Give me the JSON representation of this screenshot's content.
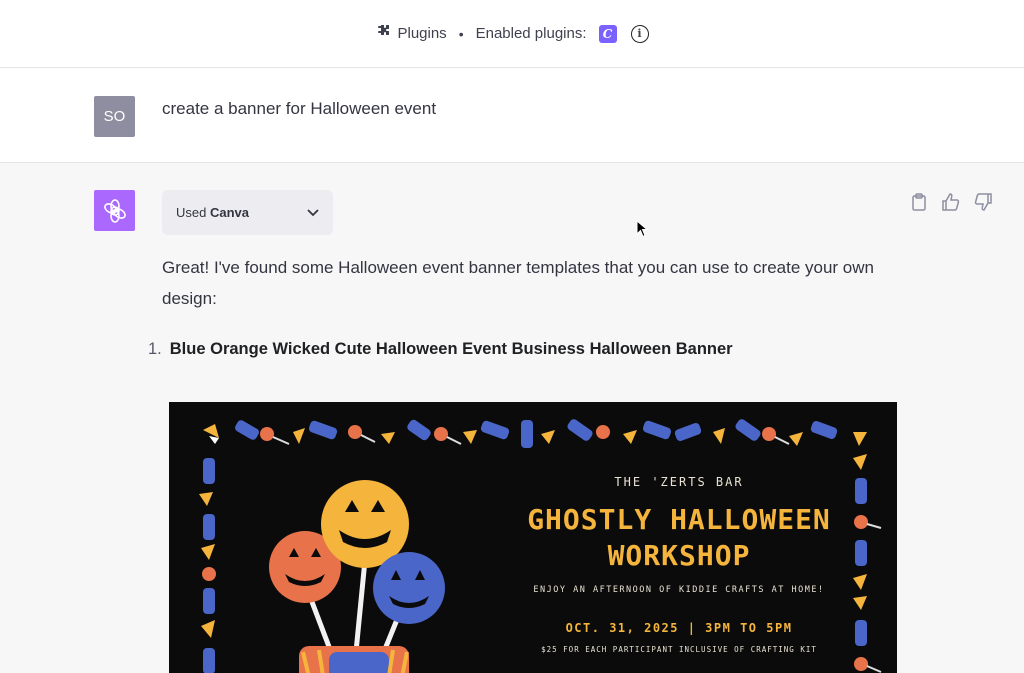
{
  "topbar": {
    "plugins_label": "Plugins",
    "separator": "•",
    "enabled_label": "Enabled plugins:",
    "plugin_badge": "C",
    "info_glyph": "i"
  },
  "user_message": {
    "avatar_initials": "SO",
    "text": "create a banner for Halloween event"
  },
  "assistant": {
    "used_prefix": "Used ",
    "used_plugin": "Canva",
    "answer_text": "Great! I've found some Halloween event banner templates that you can use to create your own design:",
    "list": [
      {
        "number": "1.",
        "title": "Blue Orange Wicked Cute Halloween Event Business Halloween Banner"
      }
    ]
  },
  "banner": {
    "subtitle": "THE 'ZERTS BAR",
    "title_line1": "GHOSTLY HALLOWEEN",
    "title_line2": "WORKSHOP",
    "tagline": "ENJOY AN AFTERNOON  OF KIDDIE CRAFTS AT HOME!",
    "date": "OCT. 31, 2025 | 3PM TO 5PM",
    "price": "$25 FOR EACH PARTICIPANT INCLUSIVE OF CRAFTING KIT"
  },
  "colors": {
    "bot_avatar": "#ab68ff",
    "user_avatar": "#8e8ea0",
    "banner_bg": "#0b0b0b",
    "banner_accent": "#f5b53d",
    "pumpkin_orange": "#e8734a",
    "pumpkin_yellow": "#f5b53d",
    "pumpkin_blue": "#4a66c8"
  },
  "icons": [
    "puzzle-icon",
    "info-icon",
    "openai-logo-icon",
    "chevron-down-icon",
    "clipboard-icon",
    "thumbs-up-icon",
    "thumbs-down-icon",
    "mouse-cursor-icon"
  ]
}
